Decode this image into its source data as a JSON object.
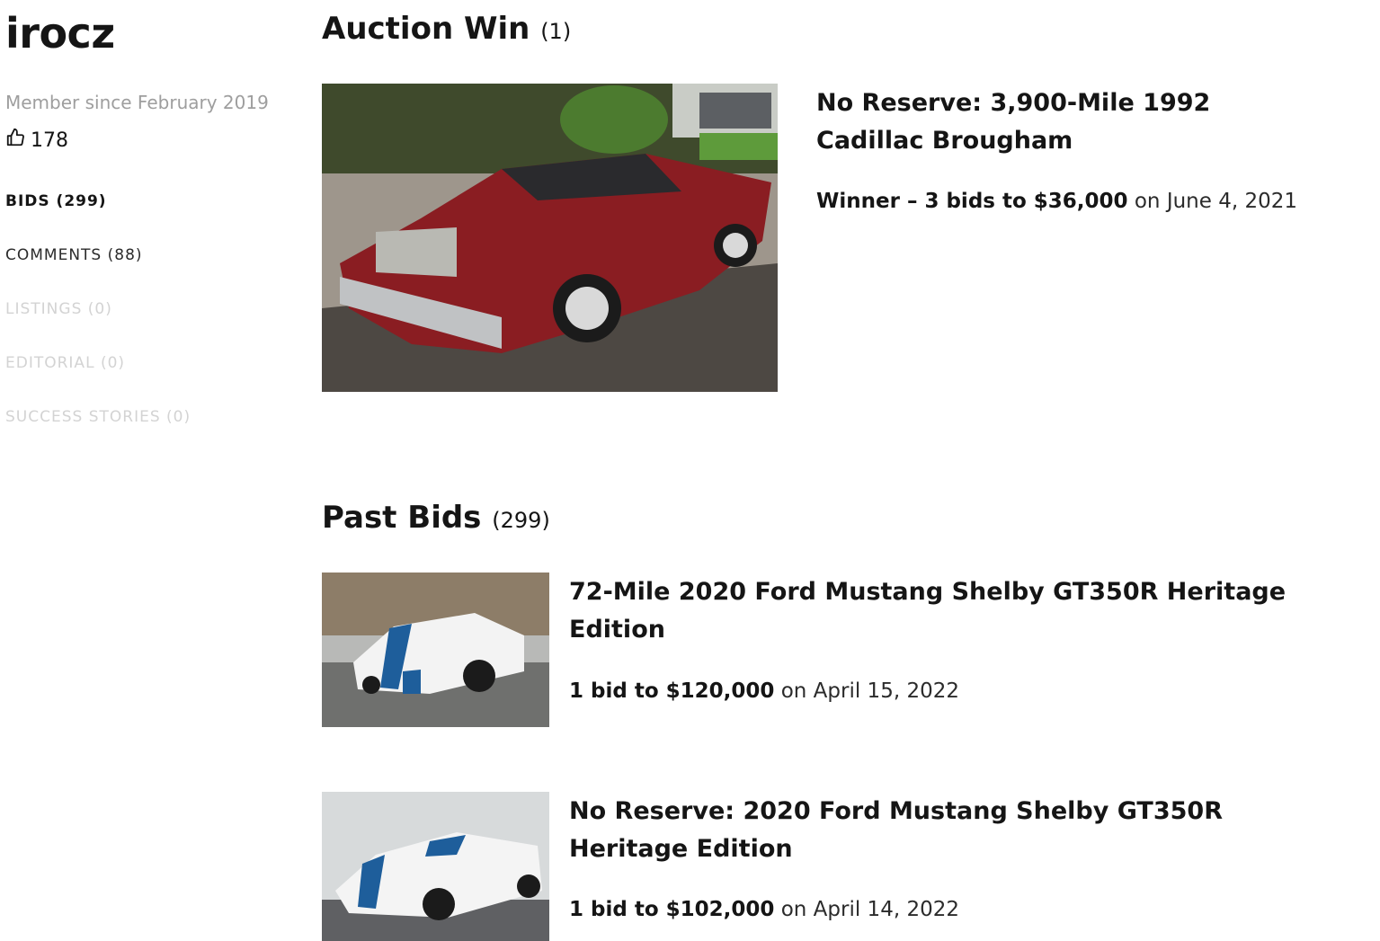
{
  "profile": {
    "username": "irocz",
    "member_since": "Member since February 2019",
    "likes": "178",
    "like_icon": "thumbs-up-icon"
  },
  "nav": [
    {
      "label": "BIDS (299)",
      "state": "active"
    },
    {
      "label": "COMMENTS (88)",
      "state": "normal"
    },
    {
      "label": "LISTINGS (0)",
      "state": "disabled"
    },
    {
      "label": "EDITORIAL (0)",
      "state": "disabled"
    },
    {
      "label": "SUCCESS STORIES (0)",
      "state": "disabled"
    }
  ],
  "auction_win": {
    "heading": "Auction Win",
    "count": "(1)",
    "items": [
      {
        "title": "No Reserve: 3,900-Mile 1992 Cadillac Brougham",
        "result_bold": "Winner – 3 bids to $36,000",
        "result_date": "on June 4, 2021"
      }
    ]
  },
  "past_bids": {
    "heading": "Past Bids",
    "count": "(299)",
    "items": [
      {
        "title": "72-Mile 2020 Ford Mustang Shelby GT350R Heritage Edition",
        "result_bold": "1 bid to $120,000",
        "result_date": "on April 15, 2022"
      },
      {
        "title": "No Reserve: 2020 Ford Mustang Shelby GT350R Heritage Edition",
        "result_bold": "1 bid to $102,000",
        "result_date": "on April 14, 2022"
      }
    ]
  },
  "colors": {
    "text": "#151515",
    "muted": "#9e9e9e",
    "disabled": "#d3d3d3"
  }
}
